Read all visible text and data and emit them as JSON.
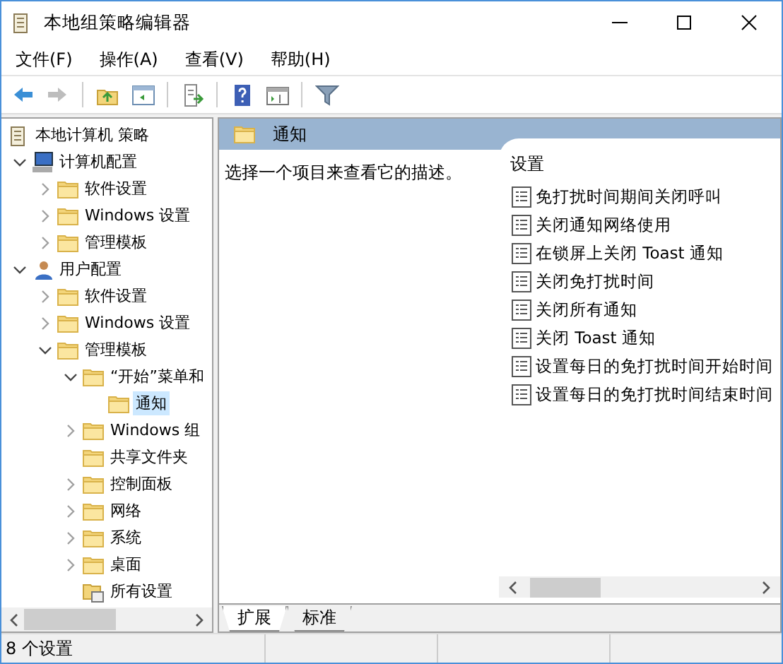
{
  "window": {
    "title": "本地组策略编辑器"
  },
  "menu": [
    {
      "label": "文件(F)"
    },
    {
      "label": "操作(A)"
    },
    {
      "label": "查看(V)"
    },
    {
      "label": "帮助(H)"
    }
  ],
  "toolbar": [
    {
      "kind": "back",
      "disabled": false
    },
    {
      "kind": "forward",
      "disabled": true
    },
    {
      "kind": "sep"
    },
    {
      "kind": "up",
      "disabled": false
    },
    {
      "kind": "pane",
      "disabled": false
    },
    {
      "kind": "sep"
    },
    {
      "kind": "export",
      "disabled": false
    },
    {
      "kind": "sep"
    },
    {
      "kind": "help",
      "disabled": false
    },
    {
      "kind": "view",
      "disabled": false
    },
    {
      "kind": "sep"
    },
    {
      "kind": "filter",
      "disabled": false
    }
  ],
  "tree": [
    {
      "label": "本地计算机 策略",
      "kind": "policy",
      "selected": false,
      "children": [
        {
          "label": "计算机配置",
          "kind": "computer",
          "expanded": true,
          "selected": false,
          "children": [
            {
              "label": "软件设置",
              "kind": "folder",
              "expanded": false,
              "selected": false
            },
            {
              "label": "Windows 设置",
              "kind": "folder",
              "expanded": false,
              "selected": false
            },
            {
              "label": "管理模板",
              "kind": "folder",
              "expanded": false,
              "selected": false
            }
          ]
        },
        {
          "label": "用户配置",
          "kind": "user",
          "expanded": true,
          "selected": false,
          "children": [
            {
              "label": "软件设置",
              "kind": "folder",
              "expanded": false,
              "selected": false
            },
            {
              "label": "Windows 设置",
              "kind": "folder",
              "expanded": false,
              "selected": false
            },
            {
              "label": "管理模板",
              "kind": "folder",
              "expanded": true,
              "selected": false,
              "children": [
                {
                  "label": "“开始”菜单和",
                  "kind": "folder",
                  "expanded": true,
                  "selected": false,
                  "children": [
                    {
                      "label": "通知",
                      "kind": "folder",
                      "selected": true
                    }
                  ]
                },
                {
                  "label": "Windows 组",
                  "kind": "folder",
                  "expanded": false,
                  "selected": false
                },
                {
                  "label": "共享文件夹",
                  "kind": "folder",
                  "selected": false
                },
                {
                  "label": "控制面板",
                  "kind": "folder",
                  "expanded": false,
                  "selected": false
                },
                {
                  "label": "网络",
                  "kind": "folder",
                  "expanded": false,
                  "selected": false
                },
                {
                  "label": "系统",
                  "kind": "folder",
                  "expanded": false,
                  "selected": false
                },
                {
                  "label": "桌面",
                  "kind": "folder",
                  "expanded": false,
                  "selected": false
                },
                {
                  "label": "所有设置",
                  "kind": "allsettings",
                  "selected": false
                }
              ]
            }
          ]
        }
      ]
    }
  ],
  "details": {
    "header": "通知",
    "description": "选择一个项目来查看它的描述。",
    "column": "设置",
    "settings": [
      {
        "label": "免打扰时间期间关闭呼叫"
      },
      {
        "label": "关闭通知网络使用"
      },
      {
        "label": "在锁屏上关闭 Toast 通知"
      },
      {
        "label": "关闭免打扰时间"
      },
      {
        "label": "关闭所有通知"
      },
      {
        "label": "关闭 Toast 通知"
      },
      {
        "label": "设置每日的免打扰时间开始时间"
      },
      {
        "label": "设置每日的免打扰时间结束时间"
      }
    ]
  },
  "tabs": [
    {
      "label": "扩展",
      "selected": true
    },
    {
      "label": "标准",
      "selected": false
    }
  ],
  "status_bar": {
    "text": "8 个设置"
  }
}
